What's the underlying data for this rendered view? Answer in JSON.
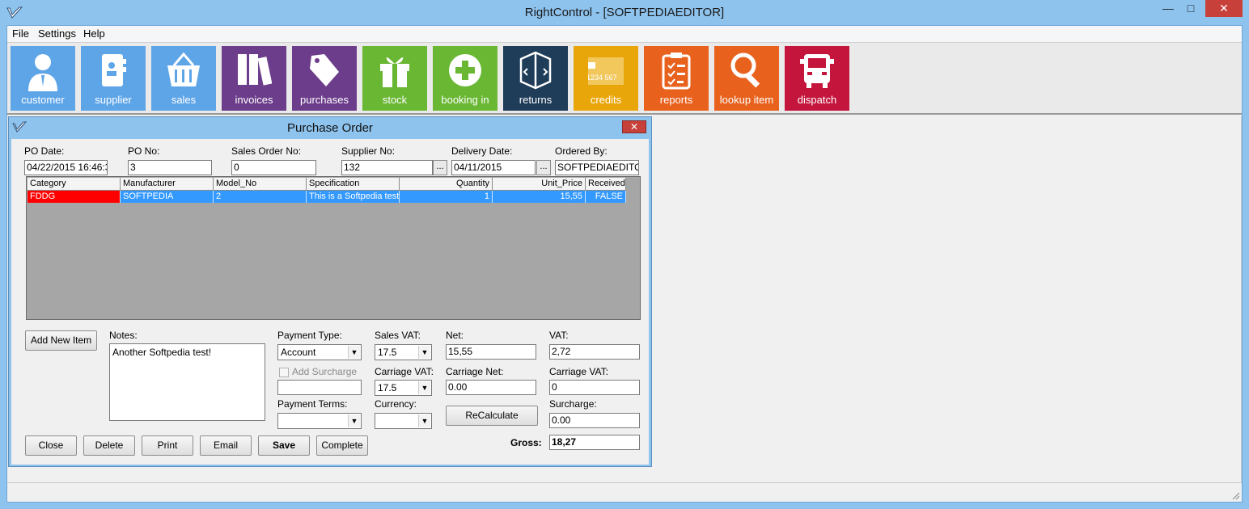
{
  "window": {
    "title": "RightControl - [SOFTPEDIAEDITOR]",
    "controls": {
      "minimize": "—",
      "maximize": "□",
      "close": "✕"
    }
  },
  "menu": [
    "File",
    "Settings",
    "Help"
  ],
  "toolbar": [
    {
      "label": "customer",
      "color": "#5ea5e8",
      "icon": "user-icon"
    },
    {
      "label": "supplier",
      "color": "#5ea5e8",
      "icon": "contact-book-icon"
    },
    {
      "label": "sales",
      "color": "#5ea5e8",
      "icon": "basket-icon"
    },
    {
      "label": "invoices",
      "color": "#6b3d8a",
      "icon": "binders-icon"
    },
    {
      "label": "purchases",
      "color": "#6b3d8a",
      "icon": "sale-tag-icon"
    },
    {
      "label": "stock",
      "color": "#6ab734",
      "icon": "gift-icon"
    },
    {
      "label": "booking in",
      "color": "#6ab734",
      "icon": "plus-icon"
    },
    {
      "label": "returns",
      "color": "#1f3c58",
      "icon": "box-icon"
    },
    {
      "label": "credits",
      "color": "#e8a60b",
      "icon": "card-icon",
      "card_text": "1234 567"
    },
    {
      "label": "reports",
      "color": "#e8621e",
      "icon": "clipboard-icon"
    },
    {
      "label": "lookup item",
      "color": "#e8621e",
      "icon": "magnifier-icon"
    },
    {
      "label": "dispatch",
      "color": "#c4163d",
      "icon": "truck-icon"
    }
  ],
  "purchase_order": {
    "title": "Purchase Order",
    "close": "✕",
    "fields": {
      "po_date": {
        "label": "PO Date:",
        "value": "04/22/2015 16:46:3"
      },
      "po_no": {
        "label": "PO No:",
        "value": "3"
      },
      "sales_order_no": {
        "label": "Sales Order No:",
        "value": "0"
      },
      "supplier_no": {
        "label": "Supplier No:",
        "value": "132"
      },
      "delivery_date": {
        "label": "Delivery Date:",
        "value": "04/11/2015"
      },
      "ordered_by": {
        "label": "Ordered By:",
        "value": "SOFTPEDIAEDITOR"
      }
    },
    "lookup_button": "...",
    "grid": {
      "columns": [
        "Category",
        "Manufacturer",
        "Model_No",
        "Specification",
        "Quantity",
        "Unit_Price",
        "Received"
      ],
      "rows": [
        [
          "FDDG",
          "SOFTPEDIA",
          "2",
          "This is a Softpedia test",
          "1",
          "15,55",
          "FALSE"
        ]
      ]
    },
    "add_new_item": "Add New Item",
    "notes": {
      "label": "Notes:",
      "value": "Another Softpedia test!"
    },
    "payment_type": {
      "label": "Payment Type:",
      "value": "Account"
    },
    "add_surcharge": {
      "label": "Add Surcharge",
      "value": ""
    },
    "payment_terms": {
      "label": "Payment Terms:",
      "value": ""
    },
    "sales_vat": {
      "label": "Sales VAT:",
      "value": "17.5"
    },
    "carriage_vat_rate": {
      "label": "Carriage VAT:",
      "value": "17.5"
    },
    "currency": {
      "label": "Currency:",
      "value": ""
    },
    "net": {
      "label": "Net:",
      "value": "15,55"
    },
    "carriage_net": {
      "label": "Carriage Net:",
      "value": "0.00"
    },
    "recalculate": "ReCalculate",
    "vat": {
      "label": "VAT:",
      "value": "2,72"
    },
    "carriage_vat": {
      "label": "Carriage VAT:",
      "value": "0"
    },
    "surcharge": {
      "label": "Surcharge:",
      "value": "0.00"
    },
    "gross": {
      "label": "Gross:",
      "value": "18,27"
    },
    "buttons": {
      "close": "Close",
      "delete": "Delete",
      "print": "Print",
      "email": "Email",
      "save": "Save",
      "complete": "Complete"
    }
  }
}
